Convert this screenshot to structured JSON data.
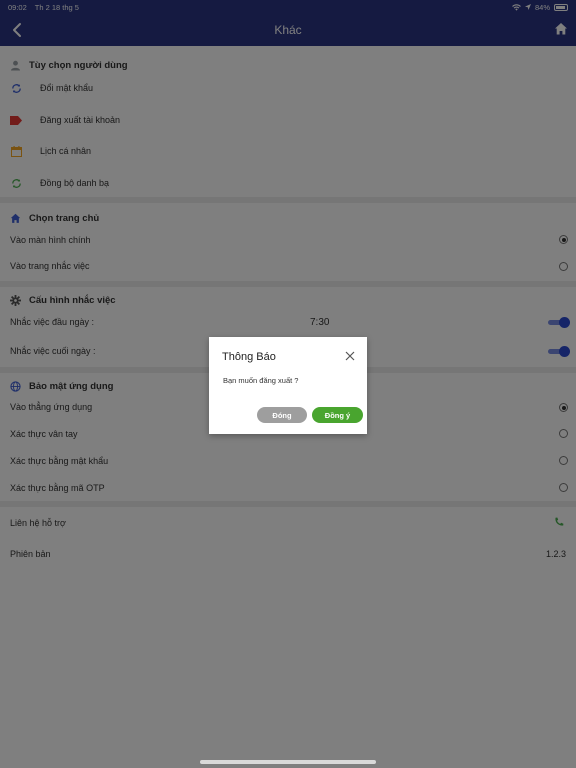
{
  "status_bar": {
    "time": "09:02",
    "date": "Th 2 18 thg 5",
    "battery": "84%"
  },
  "nav": {
    "title": "Khác"
  },
  "sections": {
    "user_options": {
      "header": "Tùy chọn người dùng",
      "items": [
        {
          "label": "Đổi mật khẩu",
          "icon": "refresh-icon",
          "color": "#3f5fd4"
        },
        {
          "label": "Đăng xuất tài khoản",
          "icon": "tag-icon",
          "color": "#e53935"
        },
        {
          "label": "Lịch cá nhân",
          "icon": "calendar-icon",
          "color": "#f5a623"
        },
        {
          "label": "Đồng bộ danh bạ",
          "icon": "sync-icon",
          "color": "#4caf50"
        }
      ]
    },
    "home_choice": {
      "header": "Chọn trang chủ",
      "items": [
        {
          "label": "Vào màn hình chính",
          "selected": true
        },
        {
          "label": "Vào trang nhắc việc",
          "selected": false
        }
      ]
    },
    "reminder_config": {
      "header": "Cấu hình nhắc việc",
      "items": [
        {
          "label": "Nhắc việc đầu ngày :",
          "time": "7:30",
          "enabled": true
        },
        {
          "label": "Nhắc việc cuối ngày :",
          "enabled": true
        }
      ]
    },
    "app_security": {
      "header": "Bảo mật ứng dụng",
      "items": [
        {
          "label": "Vào thẳng ứng dụng",
          "selected": true
        },
        {
          "label": "Xác thực vân tay",
          "selected": false
        },
        {
          "label": "Xác thực bằng mật khẩu",
          "selected": false
        },
        {
          "label": "Xác thực bằng mã OTP",
          "selected": false
        }
      ]
    },
    "support": {
      "label": "Liên hệ hỗ trợ"
    },
    "version": {
      "label": "Phiên bản",
      "value": "1.2.3"
    }
  },
  "dialog": {
    "title": "Thông Báo",
    "message": "Bạn muốn đăng xuất ?",
    "cancel_label": "Đóng",
    "confirm_label": "Đồng ý"
  },
  "colors": {
    "primary": "#2a3483",
    "confirm": "#49a52f",
    "cancel": "#9e9e9e",
    "toggle": "#2d4bd1"
  }
}
